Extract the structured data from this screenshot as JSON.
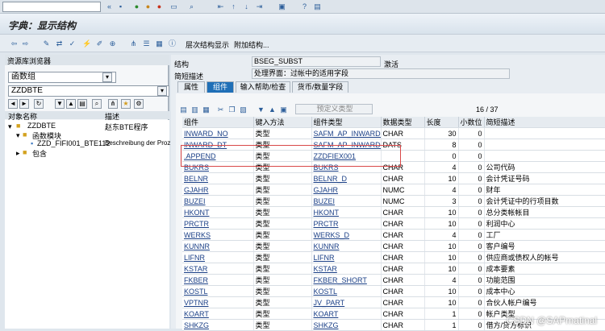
{
  "title": "字典：显示结构",
  "toolbar2": {
    "hierarchy": "层次结构显示",
    "append": "附加结构..."
  },
  "left": {
    "header": "资源库浏览器",
    "type_select": "函数组",
    "object_input": "ZZDBTE",
    "tree_col1": "对象名称",
    "tree_col2": "描述",
    "tree": [
      {
        "name": "ZZDBTE",
        "desc": "赵东BTE程序"
      },
      {
        "name": "函数模块",
        "desc": ""
      },
      {
        "name": "ZZD_FIFI001_BTE112",
        "desc": "Beschreibung der Proz"
      },
      {
        "name": "包含",
        "desc": ""
      }
    ]
  },
  "header": {
    "struct_label": "结构",
    "struct_value": "BSEG_SUBST",
    "struct_status": "激活",
    "desc_label": "简短描述",
    "desc_value": "处理界面：过帐中的适用字段"
  },
  "tabs": [
    "属性",
    "组件",
    "输入帮助/检查",
    "货币/数量字段"
  ],
  "table_toolbar": {
    "predef": "预定义类型",
    "counter": "16 / 37"
  },
  "columns": [
    "组件",
    "键入方法",
    "组件类型",
    "数据类型",
    "长度",
    "小数位",
    "简短描述"
  ],
  "rows": [
    [
      "INWARD_NO",
      "类型",
      "SAFM_AP_INWARD_",
      "CHAR",
      "30",
      "0",
      ""
    ],
    [
      "INWARD_DT",
      "类型",
      "SAFM_AP_INWARD_",
      "DATS",
      "8",
      "0",
      ""
    ],
    [
      ".APPEND",
      "类型",
      "ZZDFIEX001",
      "",
      "0",
      "0",
      ""
    ],
    [
      "BUKRS",
      "类型",
      "BUKRS",
      "CHAR",
      "4",
      "0",
      "公司代码"
    ],
    [
      "BELNR",
      "类型",
      "BELNR_D",
      "CHAR",
      "10",
      "0",
      "会计凭证号码"
    ],
    [
      "GJAHR",
      "类型",
      "GJAHR",
      "NUMC",
      "4",
      "0",
      "财年"
    ],
    [
      "BUZEI",
      "类型",
      "BUZEI",
      "NUMC",
      "3",
      "0",
      "会计凭证中的行项目数"
    ],
    [
      "HKONT",
      "类型",
      "HKONT",
      "CHAR",
      "10",
      "0",
      "总分类帐帐目"
    ],
    [
      "PRCTR",
      "类型",
      "PRCTR",
      "CHAR",
      "10",
      "0",
      "利润中心"
    ],
    [
      "WERKS",
      "类型",
      "WERKS_D",
      "CHAR",
      "4",
      "0",
      "工厂"
    ],
    [
      "KUNNR",
      "类型",
      "KUNNR",
      "CHAR",
      "10",
      "0",
      "客户编号"
    ],
    [
      "LIFNR",
      "类型",
      "LIFNR",
      "CHAR",
      "10",
      "0",
      "供应商或债权人的帐号"
    ],
    [
      "KSTAR",
      "类型",
      "KSTAR",
      "CHAR",
      "10",
      "0",
      "成本要素"
    ],
    [
      "FKBER",
      "类型",
      "FKBER_SHORT",
      "CHAR",
      "4",
      "0",
      "功能范围"
    ],
    [
      "KOSTL",
      "类型",
      "KOSTL",
      "CHAR",
      "10",
      "0",
      "成本中心"
    ],
    [
      "VPTNR",
      "类型",
      "JV_PART",
      "CHAR",
      "10",
      "0",
      "合伙人帐户编号"
    ],
    [
      "KOART",
      "类型",
      "KOART",
      "CHAR",
      "1",
      "0",
      "帐户类型"
    ],
    [
      "SHKZG",
      "类型",
      "SHKZG",
      "CHAR",
      "1",
      "0",
      "借方/贷方标识"
    ]
  ],
  "watermark": "CSDN @SAPmatinal"
}
